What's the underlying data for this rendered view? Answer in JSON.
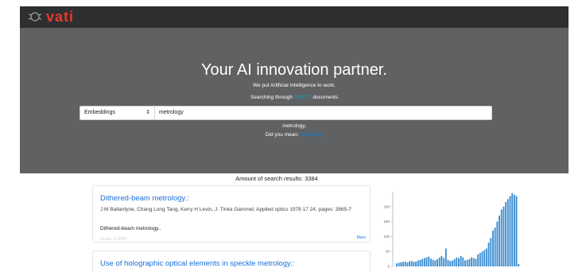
{
  "app": {
    "logo_text": "vati"
  },
  "hero": {
    "title": "Your AI innovation partner.",
    "subtitle": "We put Artificial Intelligence to work.",
    "count_prefix": "Searching through",
    "count_value": "350077",
    "count_suffix": "documents"
  },
  "search": {
    "mode_selected": "Embeddings",
    "query_value": "metrology"
  },
  "suggestion": {
    "term": "metrology,",
    "did_you_mean_label": "Did you mean:",
    "did_you_mean_link": "metrology"
  },
  "results": {
    "count_label": "Amount of search results: 3384",
    "items": [
      {
        "title": "Dithered-beam metrology.:",
        "authors": "J M Ballantyne, Chang Long Tang, Kerry H Levin, J. Tinka Gammel, Applied optics 1978 17 24, pages: 3865-7",
        "abstract": "Dithered-beam metrology..",
        "score": "score: 0.3485",
        "more_label": "More"
      },
      {
        "title": "Use of holographic optical elements in speckle metrology.:"
      }
    ]
  },
  "colors": {
    "accent": "#1a6fd6",
    "bar": "#3d8ed1",
    "brand": "#e8392e",
    "topbar": "#2e2f30",
    "hero": "#5f6163"
  },
  "chart_data": {
    "type": "bar",
    "yticks": [
      "0",
      "50",
      "100",
      "150",
      "200"
    ],
    "ylim": [
      0,
      250
    ],
    "values": [
      10,
      12,
      14,
      15,
      16,
      13,
      17,
      18,
      15,
      16,
      20,
      22,
      25,
      28,
      30,
      33,
      26,
      22,
      20,
      24,
      30,
      35,
      28,
      60,
      22,
      18,
      20,
      24,
      30,
      28,
      35,
      30,
      20,
      22,
      25,
      30,
      28,
      25,
      40,
      45,
      50,
      55,
      60,
      80,
      95,
      120,
      130,
      150,
      170,
      190,
      200,
      215,
      225,
      235,
      245,
      240,
      235,
      8
    ]
  }
}
